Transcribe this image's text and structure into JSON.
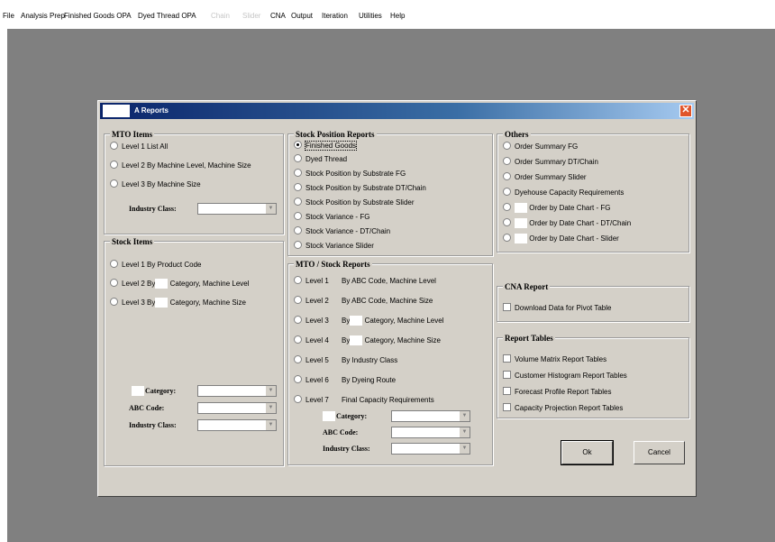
{
  "menu": [
    "File",
    "Analysis Prep",
    "Finished Goods OPA",
    "Dyed Thread OPA",
    "Chain",
    "Slider",
    "CNA",
    "Output",
    "Iteration",
    "Utilities",
    "Help"
  ],
  "menu_disabled": [
    4,
    5
  ],
  "dialog": {
    "title": "A Reports",
    "close_icon": "close-icon",
    "groups": {
      "mto_items": {
        "caption": "MTO Items",
        "options": [
          "Level 1  List All",
          "Level 2  By Machine Level, Machine Size",
          "Level 3  By  Machine Size"
        ],
        "industry_label": "Industry Class:",
        "industry_value": ""
      },
      "stock_items": {
        "caption": "Stock Items",
        "options": [
          "Level 1  By Product Code",
          "Level 2  By",
          "Category,  Machine Level",
          "Level 3  By",
          "Category,  Machine Size"
        ],
        "category_label": "Category:",
        "abc_label": "ABC Code:",
        "industry_label": "Industry Class:"
      },
      "stock_position": {
        "caption": "Stock Position Reports",
        "options": [
          "Finished Goods",
          "Dyed Thread",
          "Stock Position by Substrate FG",
          "Stock Position by Substrate DT/Chain",
          "Stock Position by Substrate Slider",
          "Stock Variance - FG",
          "Stock Variance - DT/Chain",
          "Stock Variance Slider"
        ],
        "selected": 0
      },
      "mto_stock": {
        "caption": "MTO / Stock Reports",
        "levels": [
          "Level 1",
          "Level 2",
          "Level 3",
          "Level 4",
          "Level 5",
          "Level 6",
          "Level 7"
        ],
        "descs": [
          "By ABC Code, Machine Level",
          "By ABC Code, Machine Size",
          "Category, Machine Level",
          "Category, Machine Size",
          "By Industry Class",
          "By Dyeing Route",
          "Final Capacity Requirements"
        ],
        "by3": "By",
        "by4": "By",
        "category_label": "Category:",
        "abc_label": "ABC Code:",
        "industry_label": "Industry Class:"
      },
      "others": {
        "caption": "Others",
        "options": [
          "Order Summary FG",
          "Order Summary DT/Chain",
          "Order Summary Slider",
          "Dyehouse Capacity Requirements",
          "Order by Date Chart - FG",
          "Order by Date Chart - DT/Chain",
          "Order by Date Chart - Slider"
        ]
      },
      "cna": {
        "caption": "CNA Report",
        "option": "Download Data for Pivot Table"
      },
      "report_tables": {
        "caption": "Report Tables",
        "options": [
          "Volume Matrix Report Tables",
          "Customer Histogram Report Tables",
          "Forecast Profile Report Tables",
          "Capacity Projection Report Tables"
        ]
      }
    },
    "ok_label": "Ok",
    "cancel_label": "Cancel"
  }
}
